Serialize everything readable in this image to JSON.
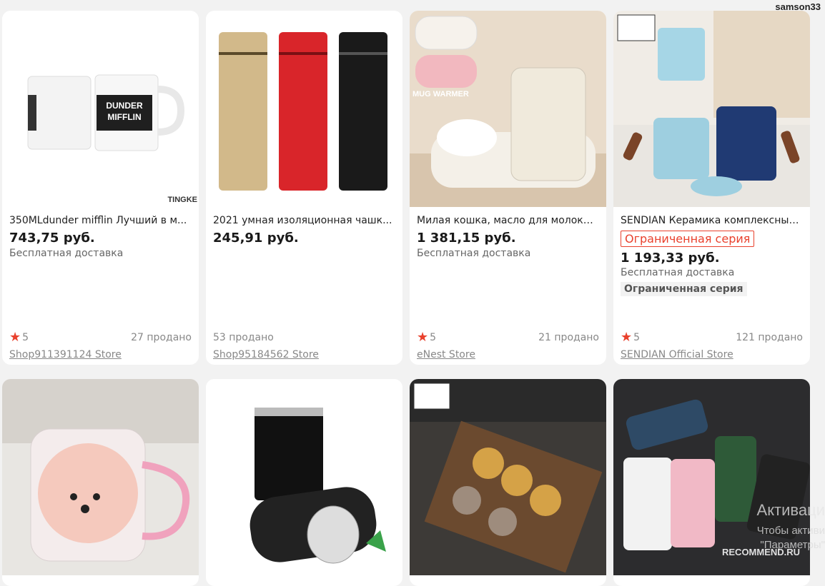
{
  "user": {
    "name": "samson33"
  },
  "products": [
    {
      "title": "350MLdunder mifflin Лучший в м...",
      "price": "743,75 руб.",
      "shipping": "Бесплатная доставка",
      "rating": "5",
      "sold": "27 продано",
      "store": "Shop911391124 Store",
      "img_text": "TINGKE"
    },
    {
      "title": "2021 умная изоляционная чашк...",
      "price": "245,91 руб.",
      "sold": "53 продано",
      "store": "Shop95184562 Store"
    },
    {
      "title": "Милая кошка, масло для молока,...",
      "price": "1 381,15 руб.",
      "shipping": "Бесплатная доставка",
      "rating": "5",
      "sold": "21 продано",
      "store": "eNest Store",
      "img_text": "MUG WARMER"
    },
    {
      "title": "SENDIAN Керамика комплексный...",
      "limited": "Ограниченная серия",
      "price": "1 193,33 руб.",
      "shipping": "Бесплатная доставка",
      "badge": "Ограниченная серия",
      "rating": "5",
      "sold": "121 продано",
      "store": "SENDIAN Official Store"
    }
  ],
  "overlay": {
    "activation_title": "Активаци",
    "activation_line1": "Чтобы активи",
    "activation_line2": "\"Параметры\"",
    "watermark": "RECOMMEND.RU"
  }
}
